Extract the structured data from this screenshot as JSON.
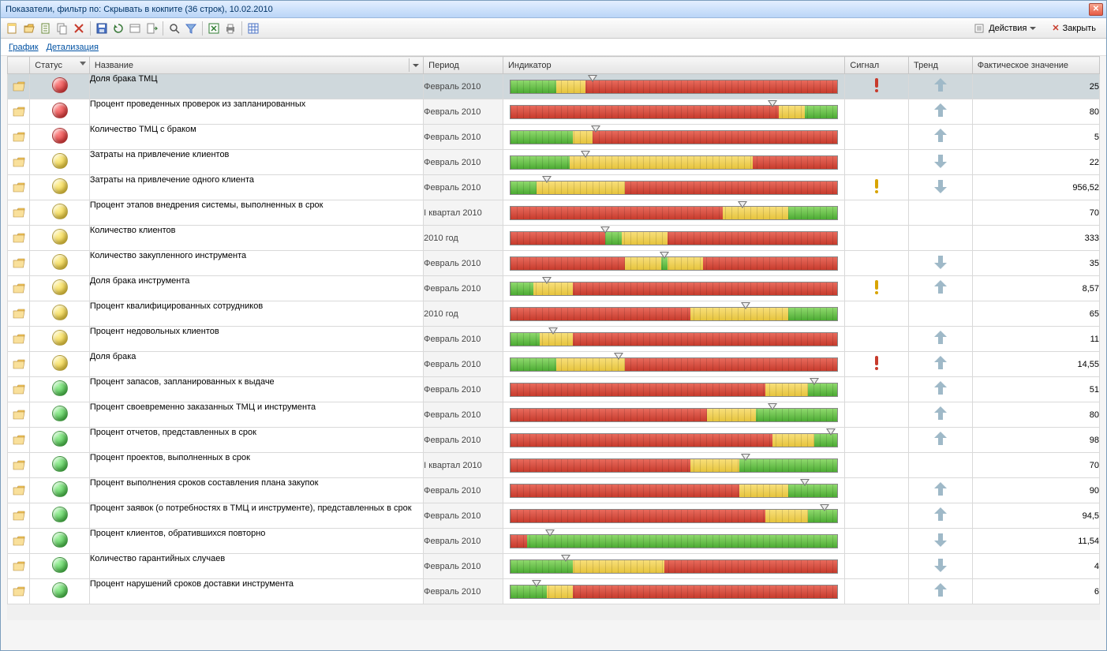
{
  "window": {
    "title": "Показатели,  фильтр по: Скрывать в кокпите (36 строк), 10.02.2010"
  },
  "toolbar": {
    "actions_label": "Действия",
    "close_label": "Закрыть"
  },
  "links": {
    "chart": "График",
    "detail": "Детализация"
  },
  "columns": {
    "status": "Статус",
    "name": "Название",
    "period": "Период",
    "indicator": "Индикатор",
    "signal": "Сигнал",
    "trend": "Тренд",
    "value": "Фактическое значение"
  },
  "rows": [
    {
      "status": "red",
      "name": "Доля брака ТМЦ",
      "period": "Февраль 2010",
      "zones": [
        [
          "green",
          14
        ],
        [
          "yellow",
          9
        ],
        [
          "red",
          77
        ]
      ],
      "marker": 25,
      "signal": "red",
      "trend": "up",
      "value": "25",
      "selected": true
    },
    {
      "status": "red",
      "name": "Процент проведенных проверок из запланированных",
      "period": "Февраль 2010",
      "zones": [
        [
          "red",
          82
        ],
        [
          "yellow",
          8
        ],
        [
          "green",
          10
        ]
      ],
      "marker": 80,
      "signal": "",
      "trend": "up",
      "value": "80"
    },
    {
      "status": "red",
      "name": "Количество ТМЦ с браком",
      "period": "Февраль 2010",
      "zones": [
        [
          "green",
          19
        ],
        [
          "yellow",
          6
        ],
        [
          "red",
          75
        ]
      ],
      "marker": 26,
      "signal": "",
      "trend": "up",
      "value": "5"
    },
    {
      "status": "yellow",
      "name": "Затраты на привлечение клиентов",
      "period": "Февраль 2010",
      "zones": [
        [
          "green",
          18
        ],
        [
          "yellow",
          56
        ],
        [
          "red",
          26
        ]
      ],
      "marker": 23,
      "signal": "",
      "trend": "down",
      "value": "22"
    },
    {
      "status": "yellow",
      "name": "Затраты на привлечение одного клиента",
      "period": "Февраль 2010",
      "zones": [
        [
          "green",
          8
        ],
        [
          "yellow",
          27
        ],
        [
          "red",
          65
        ]
      ],
      "marker": 11,
      "signal": "yellow",
      "trend": "down",
      "value": "956,52"
    },
    {
      "status": "yellow",
      "name": "Процент этапов внедрения системы, выполненных в срок",
      "period": "I квартал 2010",
      "zones": [
        [
          "red",
          65
        ],
        [
          "yellow",
          20
        ],
        [
          "green",
          15
        ]
      ],
      "marker": 71,
      "signal": "",
      "trend": "",
      "value": "70"
    },
    {
      "status": "yellow",
      "name": "Количество клиентов",
      "period": "2010 год",
      "zones": [
        [
          "red",
          29
        ],
        [
          "green",
          5
        ],
        [
          "yellow",
          14
        ],
        [
          "red",
          52
        ]
      ],
      "marker": 29,
      "signal": "",
      "trend": "",
      "value": "333"
    },
    {
      "status": "yellow",
      "name": "Количество закупленного инструмента",
      "period": "Февраль 2010",
      "zones": [
        [
          "red",
          35
        ],
        [
          "yellow",
          11
        ],
        [
          "green",
          2
        ],
        [
          "yellow",
          11
        ],
        [
          "red",
          41
        ]
      ],
      "marker": 47,
      "signal": "",
      "trend": "down",
      "value": "35"
    },
    {
      "status": "yellow",
      "name": "Доля брака инструмента",
      "period": "Февраль 2010",
      "zones": [
        [
          "green",
          7
        ],
        [
          "yellow",
          12
        ],
        [
          "red",
          81
        ]
      ],
      "marker": 11,
      "signal": "yellow",
      "trend": "up",
      "value": "8,57"
    },
    {
      "status": "yellow",
      "name": "Процент квалифицированных сотрудников",
      "period": "2010 год",
      "zones": [
        [
          "red",
          55
        ],
        [
          "yellow",
          30
        ],
        [
          "green",
          15
        ]
      ],
      "marker": 72,
      "signal": "",
      "trend": "",
      "value": "65"
    },
    {
      "status": "yellow",
      "name": "Процент недовольных клиентов",
      "period": "Февраль 2010",
      "zones": [
        [
          "green",
          9
        ],
        [
          "yellow",
          10
        ],
        [
          "red",
          81
        ]
      ],
      "marker": 13,
      "signal": "",
      "trend": "up",
      "value": "11"
    },
    {
      "status": "yellow",
      "name": "Доля брака",
      "period": "Февраль 2010",
      "zones": [
        [
          "green",
          14
        ],
        [
          "yellow",
          21
        ],
        [
          "red",
          65
        ]
      ],
      "marker": 33,
      "signal": "red",
      "trend": "up",
      "value": "14,55"
    },
    {
      "status": "green",
      "name": "Процент запасов, запланированных к выдаче",
      "period": "Февраль 2010",
      "zones": [
        [
          "red",
          78
        ],
        [
          "yellow",
          13
        ],
        [
          "green",
          9
        ]
      ],
      "marker": 93,
      "signal": "",
      "trend": "up",
      "value": "51"
    },
    {
      "status": "green",
      "name": "Процент своевременно заказанных ТМЦ и инструмента",
      "period": "Февраль 2010",
      "zones": [
        [
          "red",
          60
        ],
        [
          "yellow",
          15
        ],
        [
          "green",
          25
        ]
      ],
      "marker": 80,
      "signal": "",
      "trend": "up",
      "value": "80"
    },
    {
      "status": "green",
      "name": "Процент отчетов, представленных в срок",
      "period": "Февраль 2010",
      "zones": [
        [
          "red",
          80
        ],
        [
          "yellow",
          13
        ],
        [
          "green",
          7
        ]
      ],
      "marker": 98,
      "signal": "",
      "trend": "up",
      "value": "98"
    },
    {
      "status": "green",
      "name": "Процент проектов, выполненных в срок",
      "period": "I квартал 2010",
      "zones": [
        [
          "red",
          55
        ],
        [
          "yellow",
          15
        ],
        [
          "green",
          30
        ]
      ],
      "marker": 72,
      "signal": "",
      "trend": "",
      "value": "70"
    },
    {
      "status": "green",
      "name": "Процент выполнения сроков составления плана закупок",
      "period": "Февраль 2010",
      "zones": [
        [
          "red",
          70
        ],
        [
          "yellow",
          15
        ],
        [
          "green",
          15
        ]
      ],
      "marker": 90,
      "signal": "",
      "trend": "up",
      "value": "90"
    },
    {
      "status": "green",
      "name": "Процент заявок (о потребностях в ТМЦ и инструменте), представленных в срок",
      "period": "Февраль 2010",
      "zones": [
        [
          "red",
          78
        ],
        [
          "yellow",
          13
        ],
        [
          "green",
          9
        ]
      ],
      "marker": 96,
      "signal": "",
      "trend": "up",
      "value": "94,5"
    },
    {
      "status": "green",
      "name": "Процент клиентов, обратившихся повторно",
      "period": "Февраль 2010",
      "zones": [
        [
          "red",
          5
        ],
        [
          "green",
          95
        ]
      ],
      "marker": 12,
      "signal": "",
      "trend": "down",
      "value": "11,54"
    },
    {
      "status": "green",
      "name": "Количество гарантийных случаев",
      "period": "Февраль 2010",
      "zones": [
        [
          "green",
          19
        ],
        [
          "yellow",
          28
        ],
        [
          "red",
          53
        ]
      ],
      "marker": 17,
      "signal": "",
      "trend": "down",
      "value": "4"
    },
    {
      "status": "green",
      "name": "Процент нарушений сроков доставки инструмента",
      "period": "Февраль 2010",
      "zones": [
        [
          "green",
          11
        ],
        [
          "yellow",
          8
        ],
        [
          "red",
          81
        ]
      ],
      "marker": 8,
      "signal": "",
      "trend": "up",
      "value": "6"
    }
  ]
}
